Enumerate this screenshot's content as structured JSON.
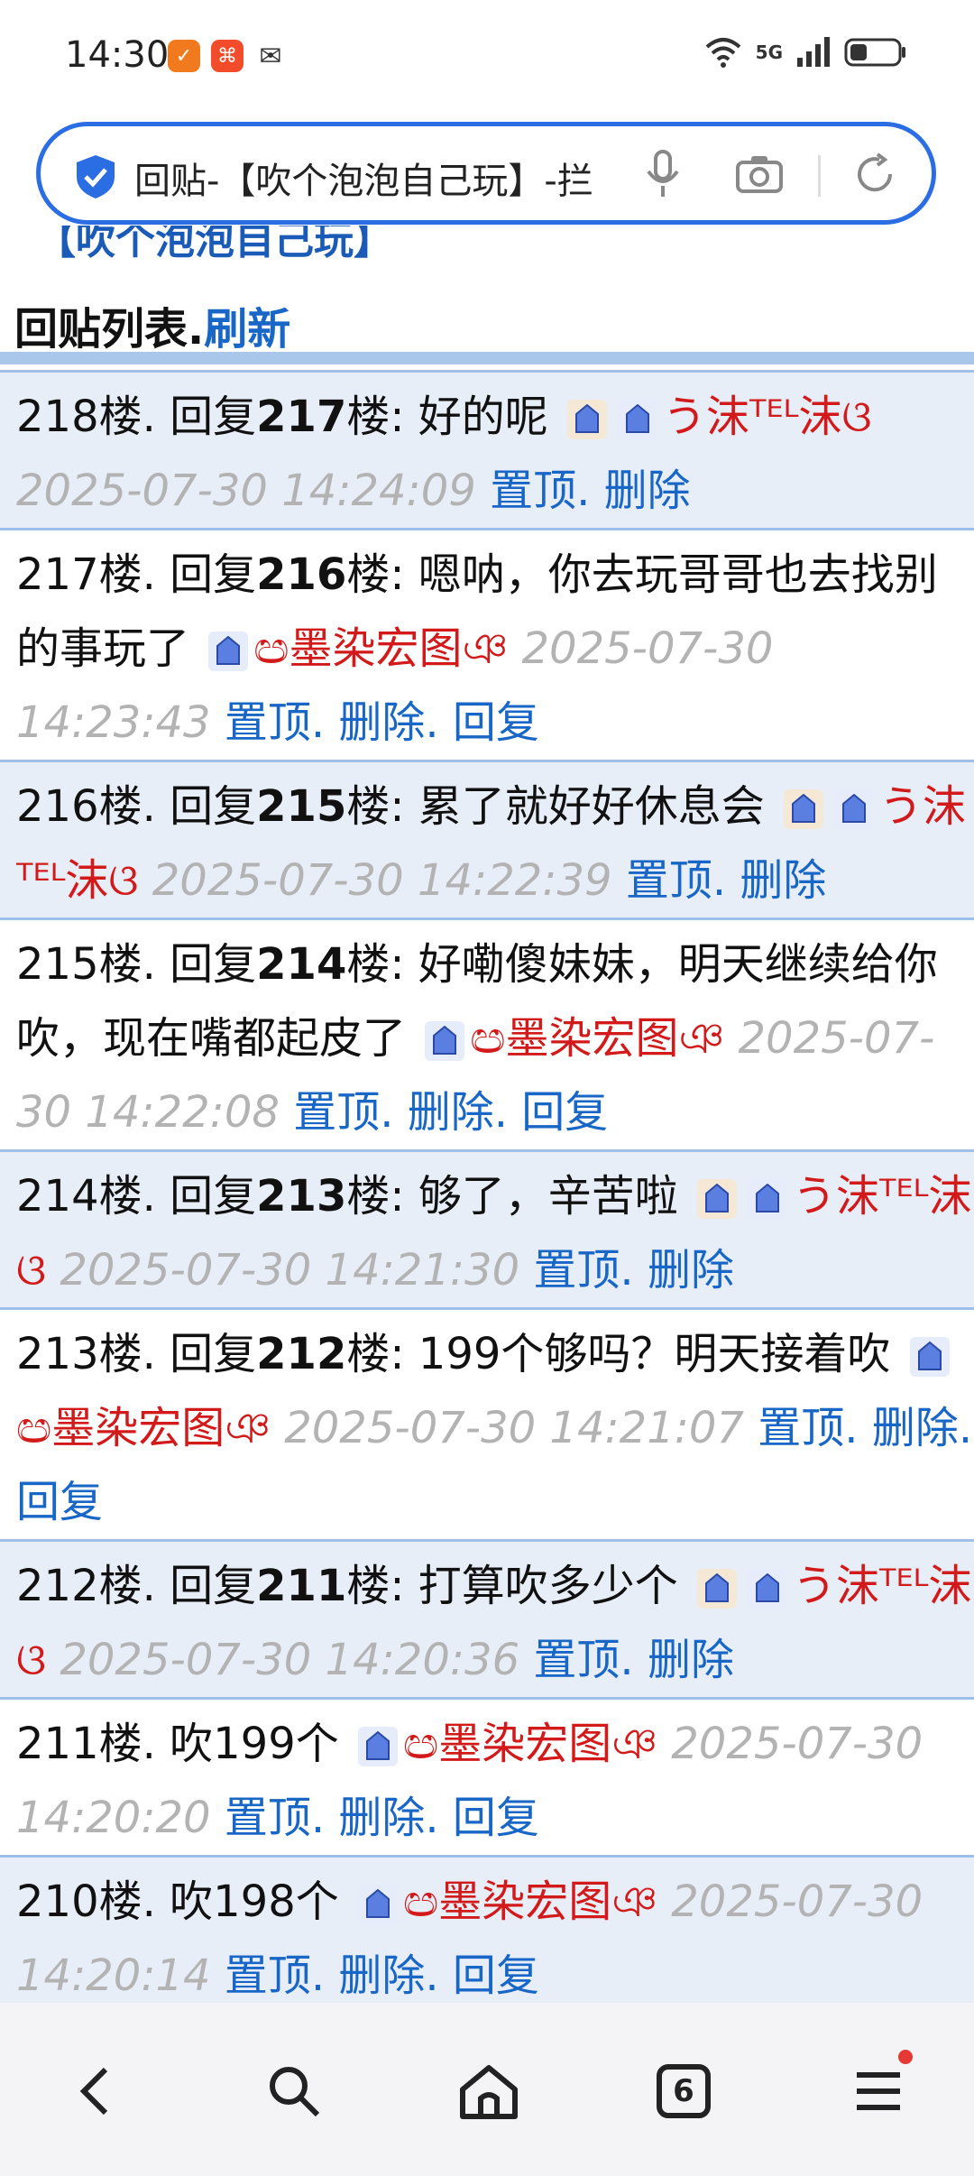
{
  "status": {
    "time": "14:30",
    "network": "5G"
  },
  "addressbar": {
    "url_text": "回贴-【吹个泡泡自己玩】-拦"
  },
  "page": {
    "heading_partial": "【吹个泡泡自己玩】",
    "list_title": "回贴列表.",
    "refresh_link": "刷新"
  },
  "posts": [
    {
      "floor": "218楼. 回复",
      "replyto": "217",
      "tail": "楼: 好的呢",
      "user": "う沫ᵀᴱᴸ沫ଓ",
      "ts": "2025-07-30 14:24:09",
      "actions": [
        "置顶",
        ". 删除"
      ]
    },
    {
      "floor": "217楼. 回复",
      "replyto": "216",
      "tail": "楼: 嗯呐，你去玩哥哥也去找别的事玩了",
      "user": "ඏ墨染宏图ঞ",
      "ts": "2025-07-30 14:23:43",
      "actions": [
        "置顶",
        ". 删除",
        ". 回复"
      ]
    },
    {
      "floor": "216楼. 回复",
      "replyto": "215",
      "tail": "楼: 累了就好好休息会",
      "user": "う沫ᵀᴱᴸ沫ଓ",
      "ts": "2025-07-30 14:22:39",
      "actions": [
        "置顶",
        ". 删除"
      ]
    },
    {
      "floor": "215楼. 回复",
      "replyto": "214",
      "tail": "楼: 好嘞傻妹妹，明天继续给你吹，现在嘴都起皮了",
      "user": "ඏ墨染宏图ঞ",
      "ts": "2025-07-30 14:22:08",
      "actions": [
        "置顶",
        ". 删除",
        ". 回复"
      ]
    },
    {
      "floor": "214楼. 回复",
      "replyto": "213",
      "tail": "楼: 够了，辛苦啦",
      "user": "う沫ᵀᴱᴸ沫ଓ",
      "ts": "2025-07-30 14:21:30",
      "actions": [
        "置顶",
        ". 删除"
      ]
    },
    {
      "floor": "213楼. 回复",
      "replyto": "212",
      "tail": "楼: 199个够吗？明天接着吹",
      "user": "ඏ墨染宏图ঞ",
      "ts": "2025-07-30 14:21:07",
      "actions": [
        "置顶",
        ". 删除",
        ". 回复"
      ]
    },
    {
      "floor": "212楼. 回复",
      "replyto": "211",
      "tail": "楼: 打算吹多少个",
      "user": "う沫ᵀᴱᴸ沫ଓ",
      "ts": "2025-07-30 14:20:36",
      "actions": [
        "置顶",
        ". 删除"
      ]
    },
    {
      "floor": "211楼. 吹199个",
      "replyto": "",
      "tail": "",
      "user": "ඏ墨染宏图ঞ",
      "ts": "2025-07-30 14:20:20",
      "actions": [
        "置顶",
        ". 删除",
        ". 回复"
      ]
    },
    {
      "floor": "210楼. 吹198个",
      "replyto": "",
      "tail": "",
      "user": "ඏ墨染宏图ঞ",
      "ts": "2025-07-30 14:20:14",
      "actions": [
        "置顶",
        ". 删除",
        ". 回复"
      ]
    }
  ],
  "bottomnav": {
    "tabs_count": "6"
  },
  "colors": {
    "link": "#1866c6",
    "user": "#d31a1a",
    "timestamp": "#b3b3b3",
    "alt_row": "#e8eef8",
    "divider": "#9ec0e8",
    "accent": "#2b6de2"
  }
}
